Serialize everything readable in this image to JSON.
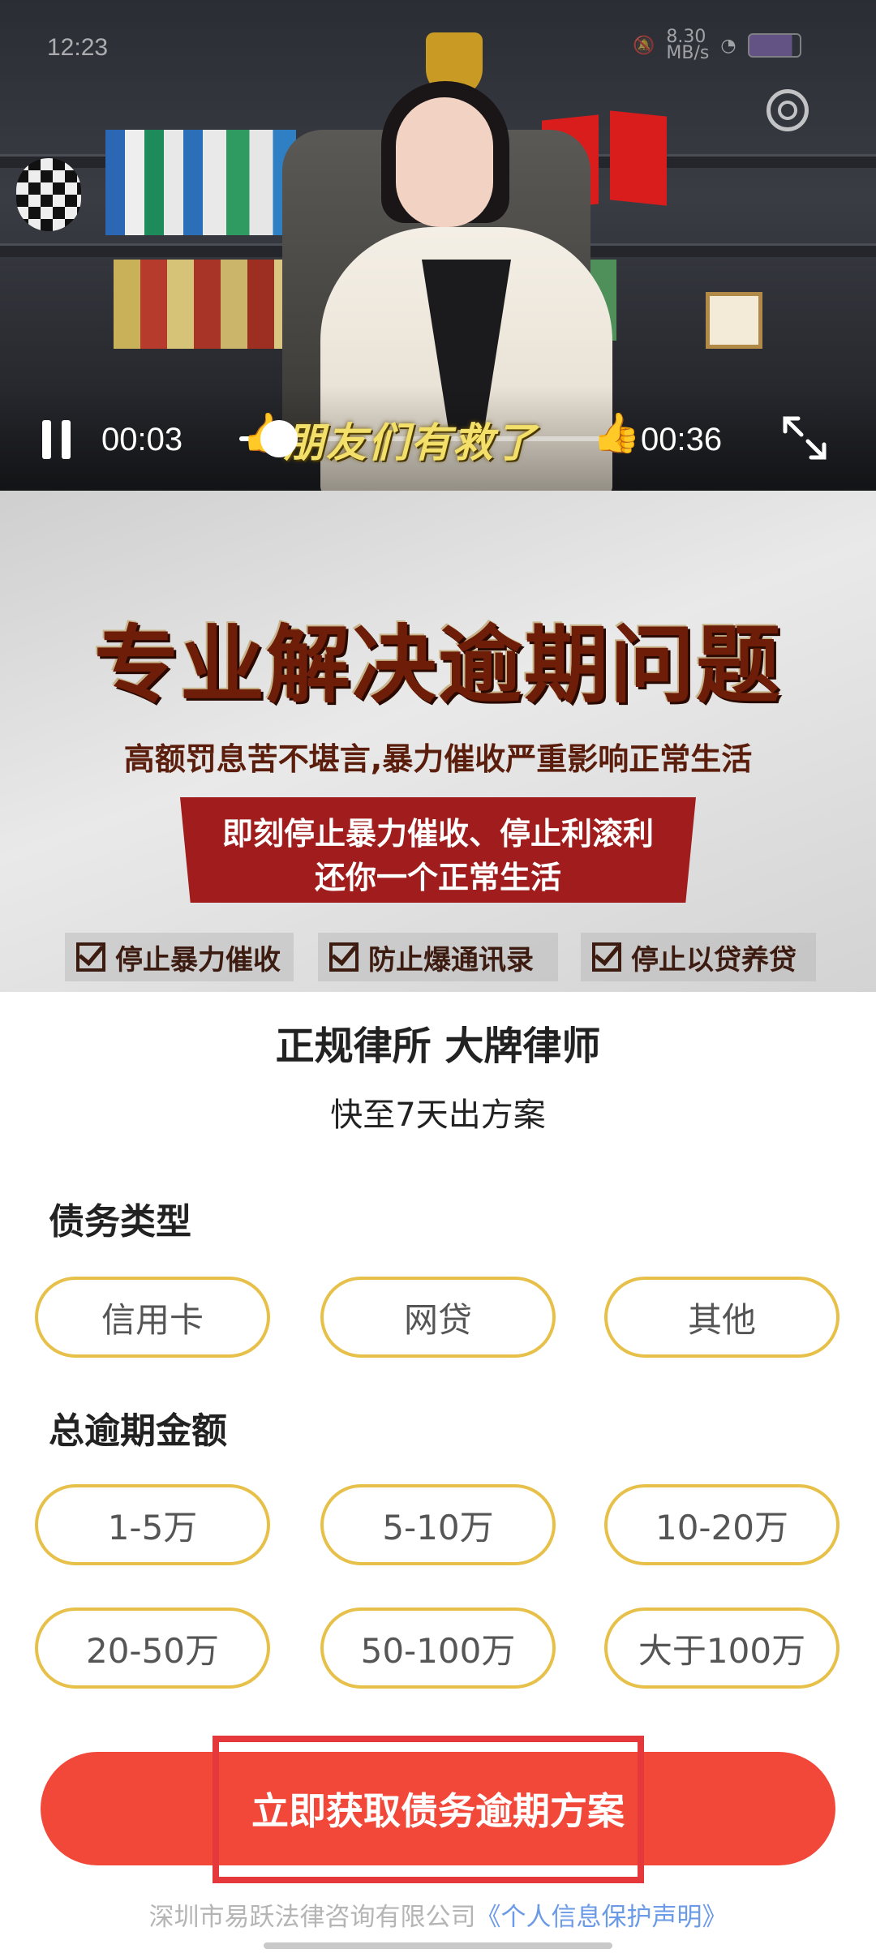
{
  "status_bar": {
    "time": "12:23",
    "speed": "8.30\nMB/s"
  },
  "video": {
    "current_time": "00:03",
    "duration": "00:36",
    "progress": 0.083,
    "caption": "朋友们有救了"
  },
  "poster": {
    "headline": "专业解决逾期问题",
    "subline": "高额罚息苦不堪言,暴力催收严重影响正常生活",
    "banner_line1": "即刻停止暴力催收、停止利滚利",
    "banner_line2": "还你一个正常生活",
    "checks": [
      "停止暴力催收",
      "防止爆通讯录",
      "停止以贷养贷"
    ]
  },
  "form": {
    "title": "正规律所 大牌律师",
    "subtitle": "快至7天出方案",
    "debt_type_label": "债务类型",
    "debt_types": [
      "信用卡",
      "网贷",
      "其他"
    ],
    "amount_label": "总逾期金额",
    "amounts": [
      "1-5万",
      "5-10万",
      "10-20万",
      "20-50万",
      "50-100万",
      "大于100万"
    ],
    "cta": "立即获取债务逾期方案"
  },
  "footer": {
    "company": "深圳市易跃法律咨询有限公司",
    "privacy_link": "《个人信息保护声明》"
  },
  "colors": {
    "accent": "#f1483a",
    "option_border": "#e7c049",
    "link": "#6b9ae6"
  }
}
